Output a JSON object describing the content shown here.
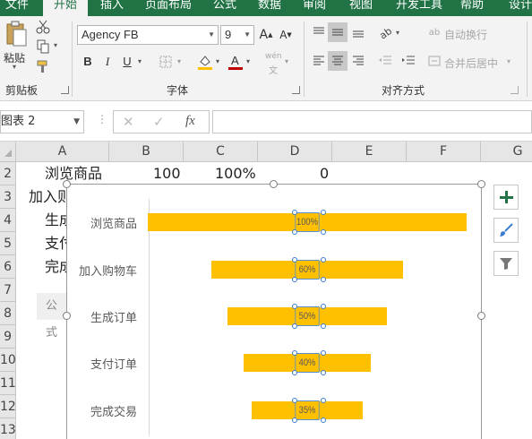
{
  "ribbon": {
    "tabs": [
      "文件",
      "开始",
      "插入",
      "页面布局",
      "公式",
      "数据",
      "审阅",
      "视图",
      "开发工具",
      "帮助",
      "设计"
    ],
    "clipboard": {
      "paste_label": "粘贴",
      "group_label": "剪贴板"
    },
    "font": {
      "name": "Agency FB",
      "size": "9",
      "bold": "B",
      "italic": "I",
      "underline": "U",
      "group_label": "字体",
      "phonetic": "wén"
    },
    "alignment": {
      "wrap_text": "自动换行",
      "merge_center": "合并后居中",
      "group_label": "对齐方式"
    }
  },
  "formula_bar": {
    "name_box": "图表 2",
    "fx": "fx",
    "cancel": "✕",
    "enter": "✓",
    "value": ""
  },
  "grid": {
    "columns": [
      "A",
      "B",
      "C",
      "D",
      "E",
      "F",
      "G"
    ],
    "rows": [
      "2",
      "3",
      "4",
      "5",
      "6",
      "7",
      "8",
      "9",
      "10",
      "11",
      "12",
      "13"
    ],
    "row2": {
      "a": "浏览商品",
      "b": "100",
      "c": "100%",
      "d": "0"
    },
    "row3_a": "加入则",
    "row4_a": "生成",
    "row5_a": "支付",
    "row6_a": "完成",
    "partial_popup": "公式"
  },
  "chart_data": {
    "type": "bar",
    "categories": [
      "浏览商品",
      "加入购物车",
      "生成订单",
      "支付订单",
      "完成交易"
    ],
    "values": [
      100,
      60,
      50,
      40,
      35
    ],
    "data_labels": [
      "100%",
      "60%",
      "50%",
      "40%",
      "35%"
    ],
    "bar_color": "#ffc000",
    "style": "funnel"
  },
  "chart_tools": [
    "add-element",
    "style-brush",
    "filter"
  ],
  "colors": {
    "excel_green": "#217346",
    "bar": "#ffc000",
    "selection_blue": "#3a7dd0"
  }
}
